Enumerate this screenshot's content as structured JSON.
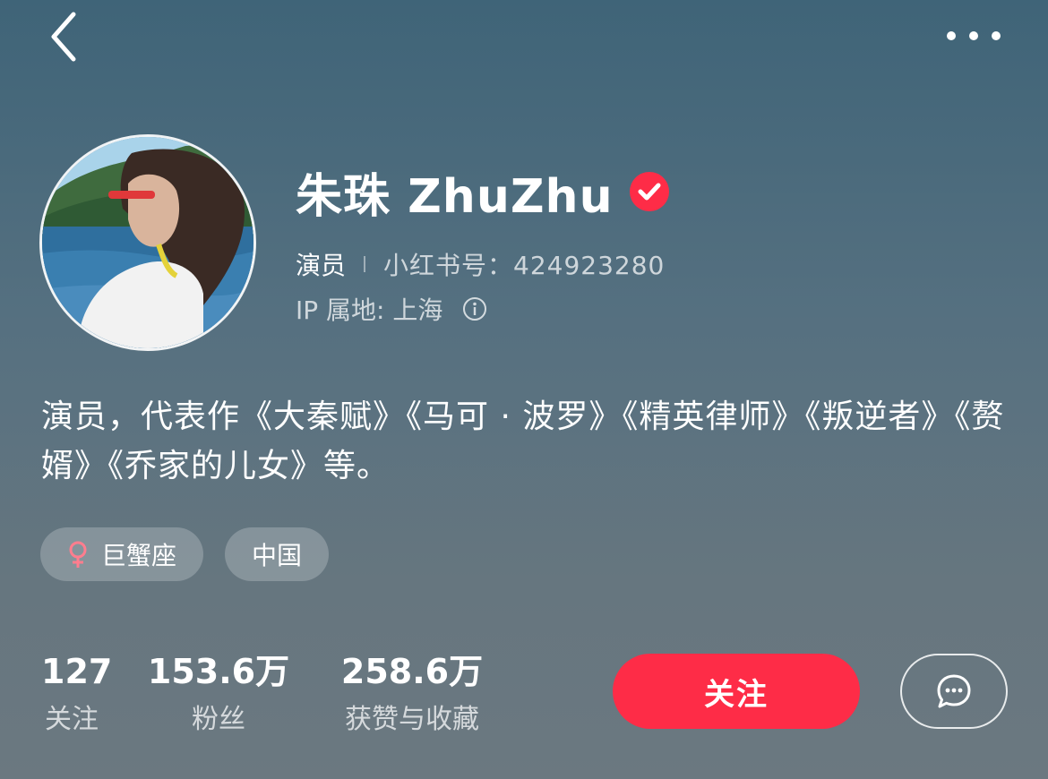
{
  "topbar": {
    "back_icon": "chevron-left-icon",
    "more_icon": "more-horizontal-icon"
  },
  "profile": {
    "name": "朱珠 ZhuZhu",
    "verified_icon": "verified-check-icon",
    "occupation": "演员",
    "redbook_id": "小红书号：424923280",
    "ip_location": "IP 属地: 上海",
    "bio": "演员，代表作《大秦赋》《马可 · 波罗》《精英律师》《叛逆者》《赘婿》《乔家的儿女》等。"
  },
  "tags": [
    {
      "icon": "female-icon",
      "label": "巨蟹座"
    },
    {
      "label": "中国"
    }
  ],
  "stats": [
    {
      "value": "127",
      "label": "关注"
    },
    {
      "value": "153.6万",
      "label": "粉丝"
    },
    {
      "value": "258.6万",
      "label": "获赞与收藏"
    }
  ],
  "actions": {
    "follow_label": "关注",
    "message_icon": "chat-bubble-icon"
  },
  "colors": {
    "accent": "#fe2c47",
    "background_top": "#3f6478",
    "background_bottom": "#6b7880"
  }
}
